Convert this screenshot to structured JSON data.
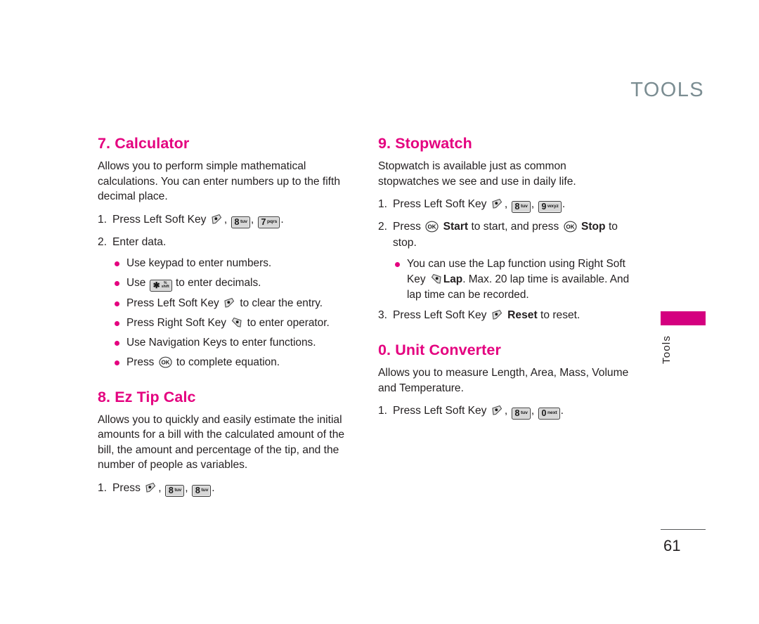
{
  "page": {
    "header_title": "TOOLS",
    "side_tab_label": "Tools",
    "side_tab_color": "#d4007f",
    "page_number": "61",
    "heading_color": "#e4007f",
    "header_color": "#7b8d92"
  },
  "left_column": {
    "sections": [
      {
        "title": "7. Calculator",
        "body": "Allows you to perform simple mathematical calculations. You can enter numbers up to the fifth decimal place.",
        "steps": [
          {
            "num": "1.",
            "text_before": "Press Left Soft Key",
            "keys": [
              "left-soft-key",
              "key-8-tuv",
              "key-7-pqrs"
            ],
            "text_after": "."
          },
          {
            "num": "2.",
            "text_before": "Enter data.",
            "keys": [],
            "text_after": ""
          }
        ],
        "bullets": [
          {
            "pre": "Use keypad to enter numbers.",
            "key": "",
            "post": ""
          },
          {
            "pre": "Use",
            "key": "key-star-shift",
            "post": "to enter decimals."
          },
          {
            "pre": "Press Left Soft Key",
            "key": "left-soft-key",
            "post": "to clear the entry."
          },
          {
            "pre": "Press Right Soft Key",
            "key": "right-soft-key",
            "post": "to enter operator."
          },
          {
            "pre": "Use Navigation Keys to enter functions.",
            "key": "",
            "post": ""
          },
          {
            "pre": "Press",
            "key": "ok-key",
            "post": "to complete equation."
          }
        ]
      },
      {
        "title": "8. Ez Tip Calc",
        "body": "Allows you to quickly and easily estimate the initial amounts for a bill with the calculated amount of the bill, the amount and percentage of the tip, and the number of people as variables.",
        "steps": [
          {
            "num": "1.",
            "text_before": "Press",
            "keys": [
              "left-soft-key",
              "key-8-tuv",
              "key-8-tuv"
            ],
            "text_after": "."
          }
        ],
        "bullets": []
      }
    ]
  },
  "right_column": {
    "sections": [
      {
        "title": "9. Stopwatch",
        "body": "Stopwatch is available just as common stopwatches we see and use in daily life.",
        "step1": {
          "num": "1.",
          "text_before": "Press Left Soft Key",
          "text_after": "."
        },
        "step2": {
          "num": "2.",
          "t1": "Press",
          "b1": "Start",
          "t2": "to start, and press",
          "b2": "Stop",
          "t3": "to stop."
        },
        "bullet": {
          "t1": "You can use the Lap function using Right Soft Key",
          "b1": "Lap",
          "t2": ". Max. 20 lap time is available. And lap time can be recorded."
        },
        "step3": {
          "num": "3.",
          "t1": "Press Left Soft Key",
          "b1": "Reset",
          "t2": "to reset."
        }
      },
      {
        "title": "0. Unit Converter",
        "body": "Allows you to measure Length, Area, Mass, Volume and Temperature.",
        "step1": {
          "num": "1.",
          "text_before": "Press Left Soft Key",
          "text_after": "."
        }
      }
    ]
  },
  "keys": {
    "key_8": {
      "digit": "8",
      "label": "tuv"
    },
    "key_7": {
      "digit": "7",
      "label": "pqrs"
    },
    "key_9": {
      "digit": "9",
      "label": "wxyz"
    },
    "key_0": {
      "digit": "0",
      "label": "next"
    },
    "key_star": {
      "glyph": "✱",
      "line1": "%",
      "line2": "shift"
    }
  }
}
